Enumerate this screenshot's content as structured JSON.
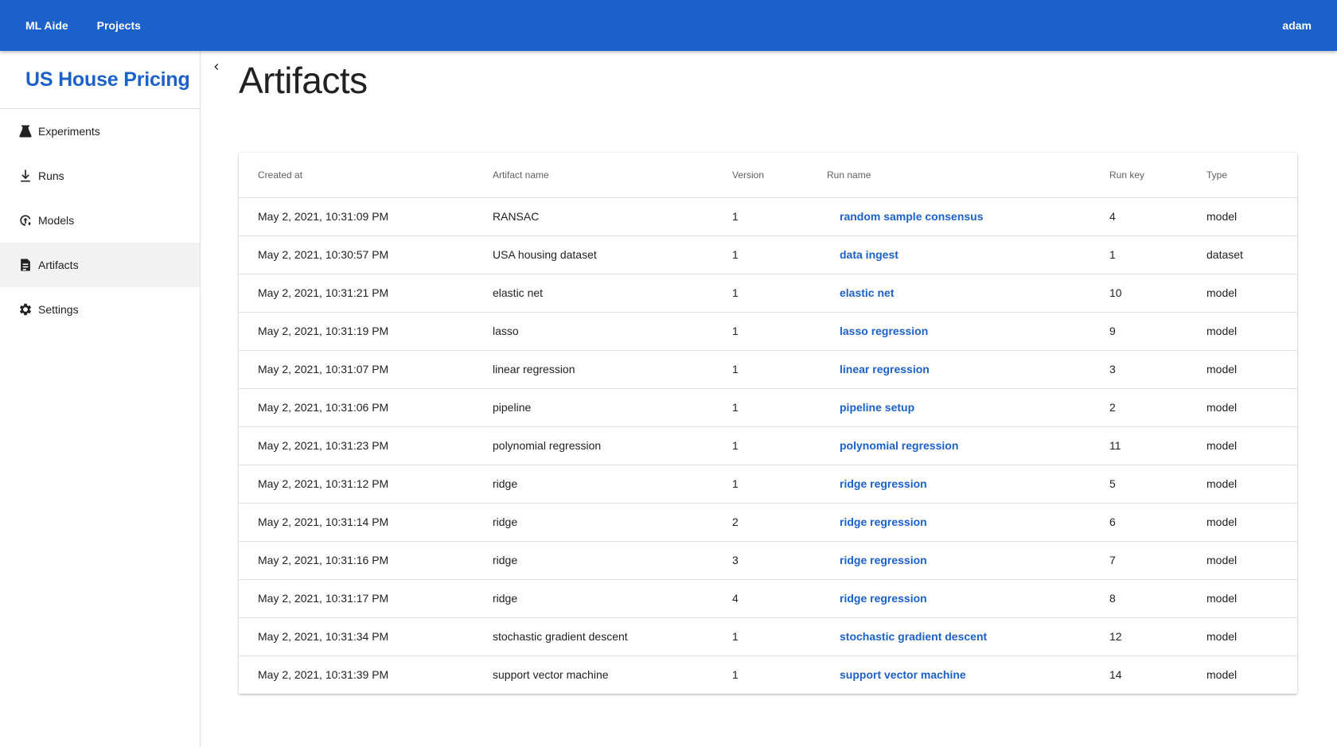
{
  "appbar": {
    "brand": "ML Aide",
    "projects": "Projects",
    "user": "adam",
    "color": "#1b61c9"
  },
  "sidebar": {
    "project_title": "US House Pricing",
    "items": [
      {
        "label": "Experiments",
        "icon": "flask-icon"
      },
      {
        "label": "Runs",
        "icon": "run-icon"
      },
      {
        "label": "Models",
        "icon": "model-icon"
      },
      {
        "label": "Artifacts",
        "icon": "document-icon",
        "active": true
      },
      {
        "label": "Settings",
        "icon": "gear-icon"
      }
    ]
  },
  "page": {
    "title": "Artifacts"
  },
  "table": {
    "headers": [
      "Created at",
      "Artifact name",
      "Version",
      "Run name",
      "Run key",
      "Type"
    ],
    "rows": [
      {
        "created": "May 2, 2021, 10:31:09 PM",
        "name": "RANSAC",
        "version": "1",
        "run": "random sample consensus",
        "key": "4",
        "type": "model"
      },
      {
        "created": "May 2, 2021, 10:30:57 PM",
        "name": "USA housing dataset",
        "version": "1",
        "run": "data ingest",
        "key": "1",
        "type": "dataset"
      },
      {
        "created": "May 2, 2021, 10:31:21 PM",
        "name": "elastic net",
        "version": "1",
        "run": "elastic net",
        "key": "10",
        "type": "model"
      },
      {
        "created": "May 2, 2021, 10:31:19 PM",
        "name": "lasso",
        "version": "1",
        "run": "lasso regression",
        "key": "9",
        "type": "model"
      },
      {
        "created": "May 2, 2021, 10:31:07 PM",
        "name": "linear regression",
        "version": "1",
        "run": "linear regression",
        "key": "3",
        "type": "model"
      },
      {
        "created": "May 2, 2021, 10:31:06 PM",
        "name": "pipeline",
        "version": "1",
        "run": "pipeline setup",
        "key": "2",
        "type": "model"
      },
      {
        "created": "May 2, 2021, 10:31:23 PM",
        "name": "polynomial regression",
        "version": "1",
        "run": "polynomial regression",
        "key": "11",
        "type": "model"
      },
      {
        "created": "May 2, 2021, 10:31:12 PM",
        "name": "ridge",
        "version": "1",
        "run": "ridge regression",
        "key": "5",
        "type": "model"
      },
      {
        "created": "May 2, 2021, 10:31:14 PM",
        "name": "ridge",
        "version": "2",
        "run": "ridge regression",
        "key": "6",
        "type": "model"
      },
      {
        "created": "May 2, 2021, 10:31:16 PM",
        "name": "ridge",
        "version": "3",
        "run": "ridge regression",
        "key": "7",
        "type": "model"
      },
      {
        "created": "May 2, 2021, 10:31:17 PM",
        "name": "ridge",
        "version": "4",
        "run": "ridge regression",
        "key": "8",
        "type": "model"
      },
      {
        "created": "May 2, 2021, 10:31:34 PM",
        "name": "stochastic gradient descent",
        "version": "1",
        "run": "stochastic gradient descent",
        "key": "12",
        "type": "model"
      },
      {
        "created": "May 2, 2021, 10:31:39 PM",
        "name": "support vector machine",
        "version": "1",
        "run": "support vector machine",
        "key": "14",
        "type": "model"
      }
    ]
  }
}
